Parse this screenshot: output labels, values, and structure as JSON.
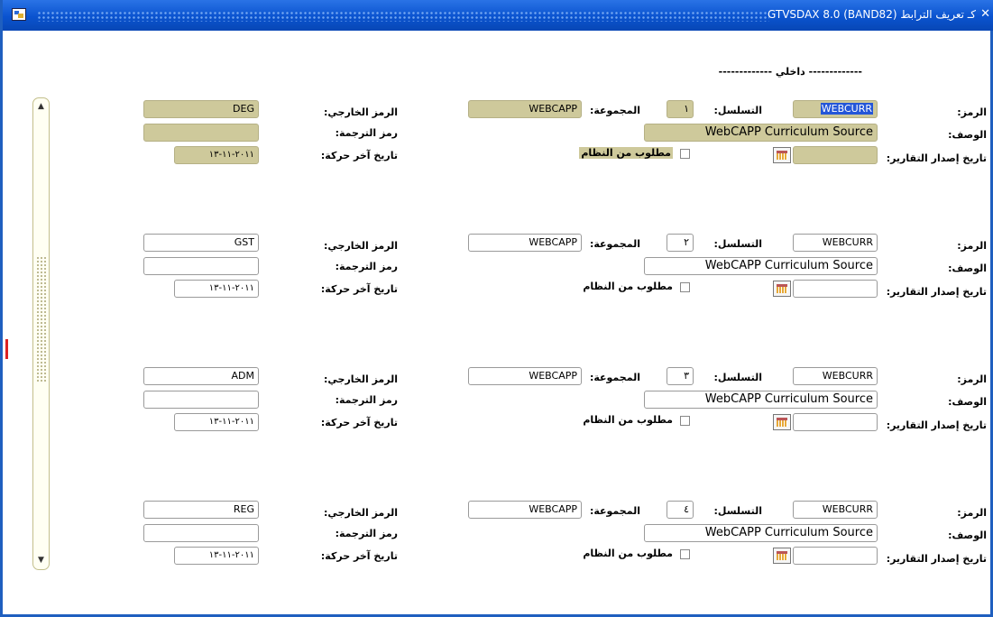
{
  "window": {
    "title": "كـ تعريف الترابط  (GTVSDAX  8.0  (BAND82",
    "close_glyph": "✕"
  },
  "header": {
    "internal": "------------- داخلي -------------"
  },
  "labels": {
    "code": "الرمز:",
    "seq": "التسلسل:",
    "group": "المجموعة:",
    "external_code": "الرمز الخارجي:",
    "description": "الوصف:",
    "translation_code": "رمز الترجمة:",
    "report_date": "تاريخ إصدار التقارير:",
    "system_required": "مطلوب من النظام",
    "last_activity": "تاريخ آخر حركة:"
  },
  "records": [
    {
      "code": "WEBCURR",
      "seq": "١",
      "group": "WEBCAPP",
      "external_code": "DEG",
      "description": "WebCAPP Curriculum Source",
      "translation_code": "",
      "report_date": "",
      "last_activity": "٢٠١١-١١-١٣"
    },
    {
      "code": "WEBCURR",
      "seq": "٢",
      "group": "WEBCAPP",
      "external_code": "GST",
      "description": "WebCAPP Curriculum Source",
      "translation_code": "",
      "report_date": "",
      "last_activity": "٢٠١١-١١-١٣"
    },
    {
      "code": "WEBCURR",
      "seq": "٣",
      "group": "WEBCAPP",
      "external_code": "ADM",
      "description": "WebCAPP Curriculum Source",
      "translation_code": "",
      "report_date": "",
      "last_activity": "٢٠١١-١١-١٣"
    },
    {
      "code": "WEBCURR",
      "seq": "٤",
      "group": "WEBCAPP",
      "external_code": "REG",
      "description": "WebCAPP Curriculum Source",
      "translation_code": "",
      "report_date": "",
      "last_activity": "٢٠١١-١١-١٣"
    }
  ],
  "colors": {
    "title_bar": "#0a58d6",
    "highlight_field": "#cec99b",
    "selection": "#2456d8"
  },
  "icons": {
    "app": "app-icon",
    "calendar": "calendar-icon",
    "scroll_up": "scroll-up-icon",
    "scroll_down": "scroll-down-icon"
  }
}
